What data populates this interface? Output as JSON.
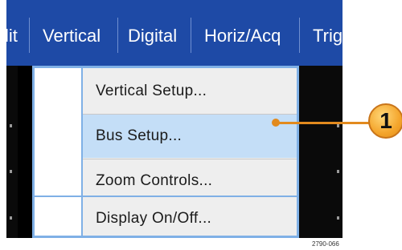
{
  "menubar": {
    "items": [
      {
        "label": "lit"
      },
      {
        "label": "Vertical"
      },
      {
        "label": "Digital"
      },
      {
        "label": "Horiz/Acq"
      },
      {
        "label": "Trig"
      }
    ]
  },
  "dropdown": {
    "items": [
      {
        "label": "Vertical Setup..."
      },
      {
        "label": "Bus Setup...",
        "highlighted": true
      },
      {
        "label": "Zoom Controls..."
      },
      {
        "label": "Display On/Off..."
      }
    ]
  },
  "callout": {
    "number": "1"
  },
  "figure_ref": "2790-066",
  "colors": {
    "menubar": "#1e4aa6",
    "highlight": "#c4def7",
    "menu_border": "#7fb0e6",
    "callout": "#e28a1e"
  }
}
